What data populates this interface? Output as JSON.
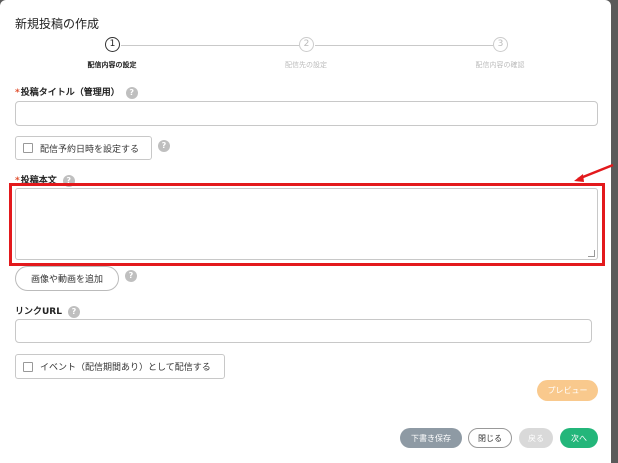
{
  "dialog": {
    "title": "新規投稿の作成"
  },
  "steps": [
    {
      "number": "1",
      "label": "配信内容の設定"
    },
    {
      "number": "2",
      "label": "配信先の設定"
    },
    {
      "number": "3",
      "label": "配信内容の確認"
    }
  ],
  "form": {
    "required_mark": "*",
    "post_title": {
      "label": "投稿タイトル（管理用）",
      "value": ""
    },
    "schedule_checkbox": {
      "label": "配信予約日時を設定する",
      "checked": false
    },
    "post_body": {
      "label": "投稿本文",
      "value": ""
    },
    "add_media_label": "画像や動画を追加",
    "link_url": {
      "label": "リンクURL",
      "value": ""
    },
    "event_checkbox": {
      "label": "イベント（配信期間あり）として配信する",
      "checked": false
    },
    "help_glyph": "?"
  },
  "buttons": {
    "preview": "プレビュー",
    "save_draft": "下書き保存",
    "close": "閉じる",
    "back": "戻る",
    "next": "次へ"
  },
  "colors": {
    "accent_green": "#23b67a",
    "preview_orange": "#f9c98d",
    "highlight_red": "#e3191c",
    "required_red": "#e05030"
  }
}
